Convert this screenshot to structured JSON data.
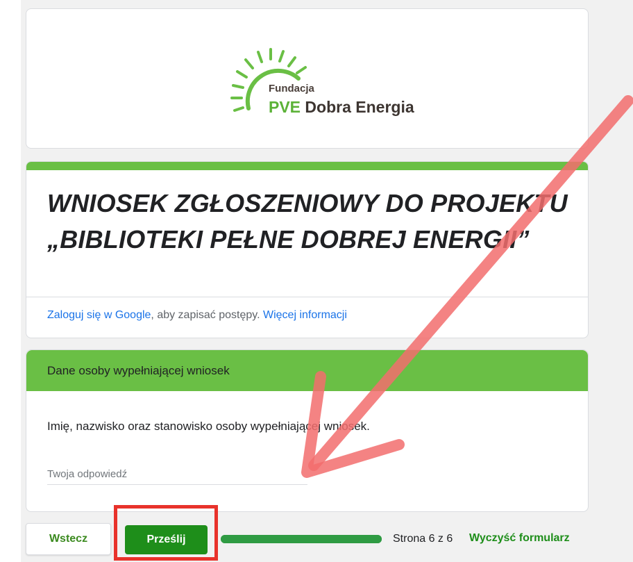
{
  "logo": {
    "line1": "Fundacja",
    "line2_accent": "PVE",
    "line2_rest": " Dobra Energia"
  },
  "form": {
    "title": "WNIOSEK ZGŁOSZENIOWY DO PROJEKTU „BIBLIOTEKI PEŁNE DOBREJ ENERGII”",
    "signin_link": "Zaloguj się w Google",
    "signin_text": ", aby zapisać postępy. ",
    "more_info_link": "Więcej informacji"
  },
  "section": {
    "title": "Dane osoby wypełniającej wniosek",
    "question": "Imię, nazwisko oraz stanowisko osoby wypełniającej wniosek.",
    "answer_placeholder": "Twoja odpowiedź",
    "answer_value": ""
  },
  "footer": {
    "back_label": "Wstecz",
    "submit_label": "Prześlij",
    "page_indicator": "Strona 6 z 6",
    "clear_label": "Wyczyść formularz",
    "progress_percent": 100
  },
  "colors": {
    "brand_green": "#6abf45",
    "submit_green": "#1e8e1a",
    "link_blue": "#1a73e8",
    "annotation_red": "#e8322b"
  }
}
